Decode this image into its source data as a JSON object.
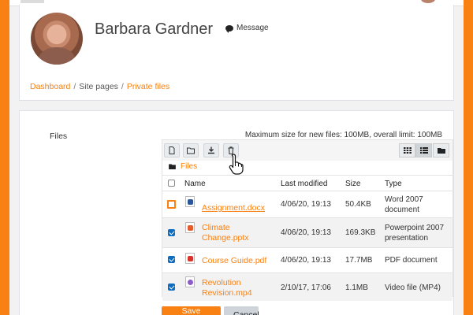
{
  "user": {
    "name": "Barbara Gardner",
    "message_label": "Message"
  },
  "breadcrumb": [
    {
      "label": "Dashboard",
      "link": true
    },
    {
      "label": "Site pages",
      "link": false
    },
    {
      "label": "Private files",
      "link": true
    }
  ],
  "breadcrumb_sep": "/",
  "form": {
    "files_label": "Files",
    "max_size_text": "Maximum size for new files: 100MB, overall limit: 100MB",
    "path_label": "Files",
    "save_label": "Save changes",
    "cancel_label": "Cancel"
  },
  "toolbar": {
    "icons": [
      "add-file-icon",
      "create-folder-icon",
      "download-icon",
      "delete-icon"
    ],
    "views": [
      "grid-view-icon",
      "list-view-icon",
      "tree-view-icon"
    ],
    "active_view": "list-view-icon"
  },
  "table": {
    "headers": {
      "name": "Name",
      "modified": "Last modified",
      "size": "Size",
      "type": "Type"
    },
    "rows": [
      {
        "name": "Assignment.docx",
        "modified": "4/06/20, 19:13",
        "size": "50.4KB",
        "type": "Word 2007 document",
        "icon": "docx",
        "checked": false,
        "focused": true
      },
      {
        "name": "Climate Change.pptx",
        "modified": "4/06/20, 19:13",
        "size": "169.3KB",
        "type": "Powerpoint 2007 presentation",
        "icon": "pptx",
        "checked": true,
        "focused": false
      },
      {
        "name": "Course Guide.pdf",
        "modified": "4/06/20, 19:13",
        "size": "17.7MB",
        "type": "PDF document",
        "icon": "pdf",
        "checked": true,
        "focused": false
      },
      {
        "name": "Revolution Revision.mp4",
        "modified": "2/10/17, 17:06",
        "size": "1.1MB",
        "type": "Video file (MP4)",
        "icon": "mp4",
        "checked": true,
        "focused": false
      }
    ]
  },
  "colors": {
    "brand": "#f98012",
    "checkbox": "#0f6cbf"
  }
}
